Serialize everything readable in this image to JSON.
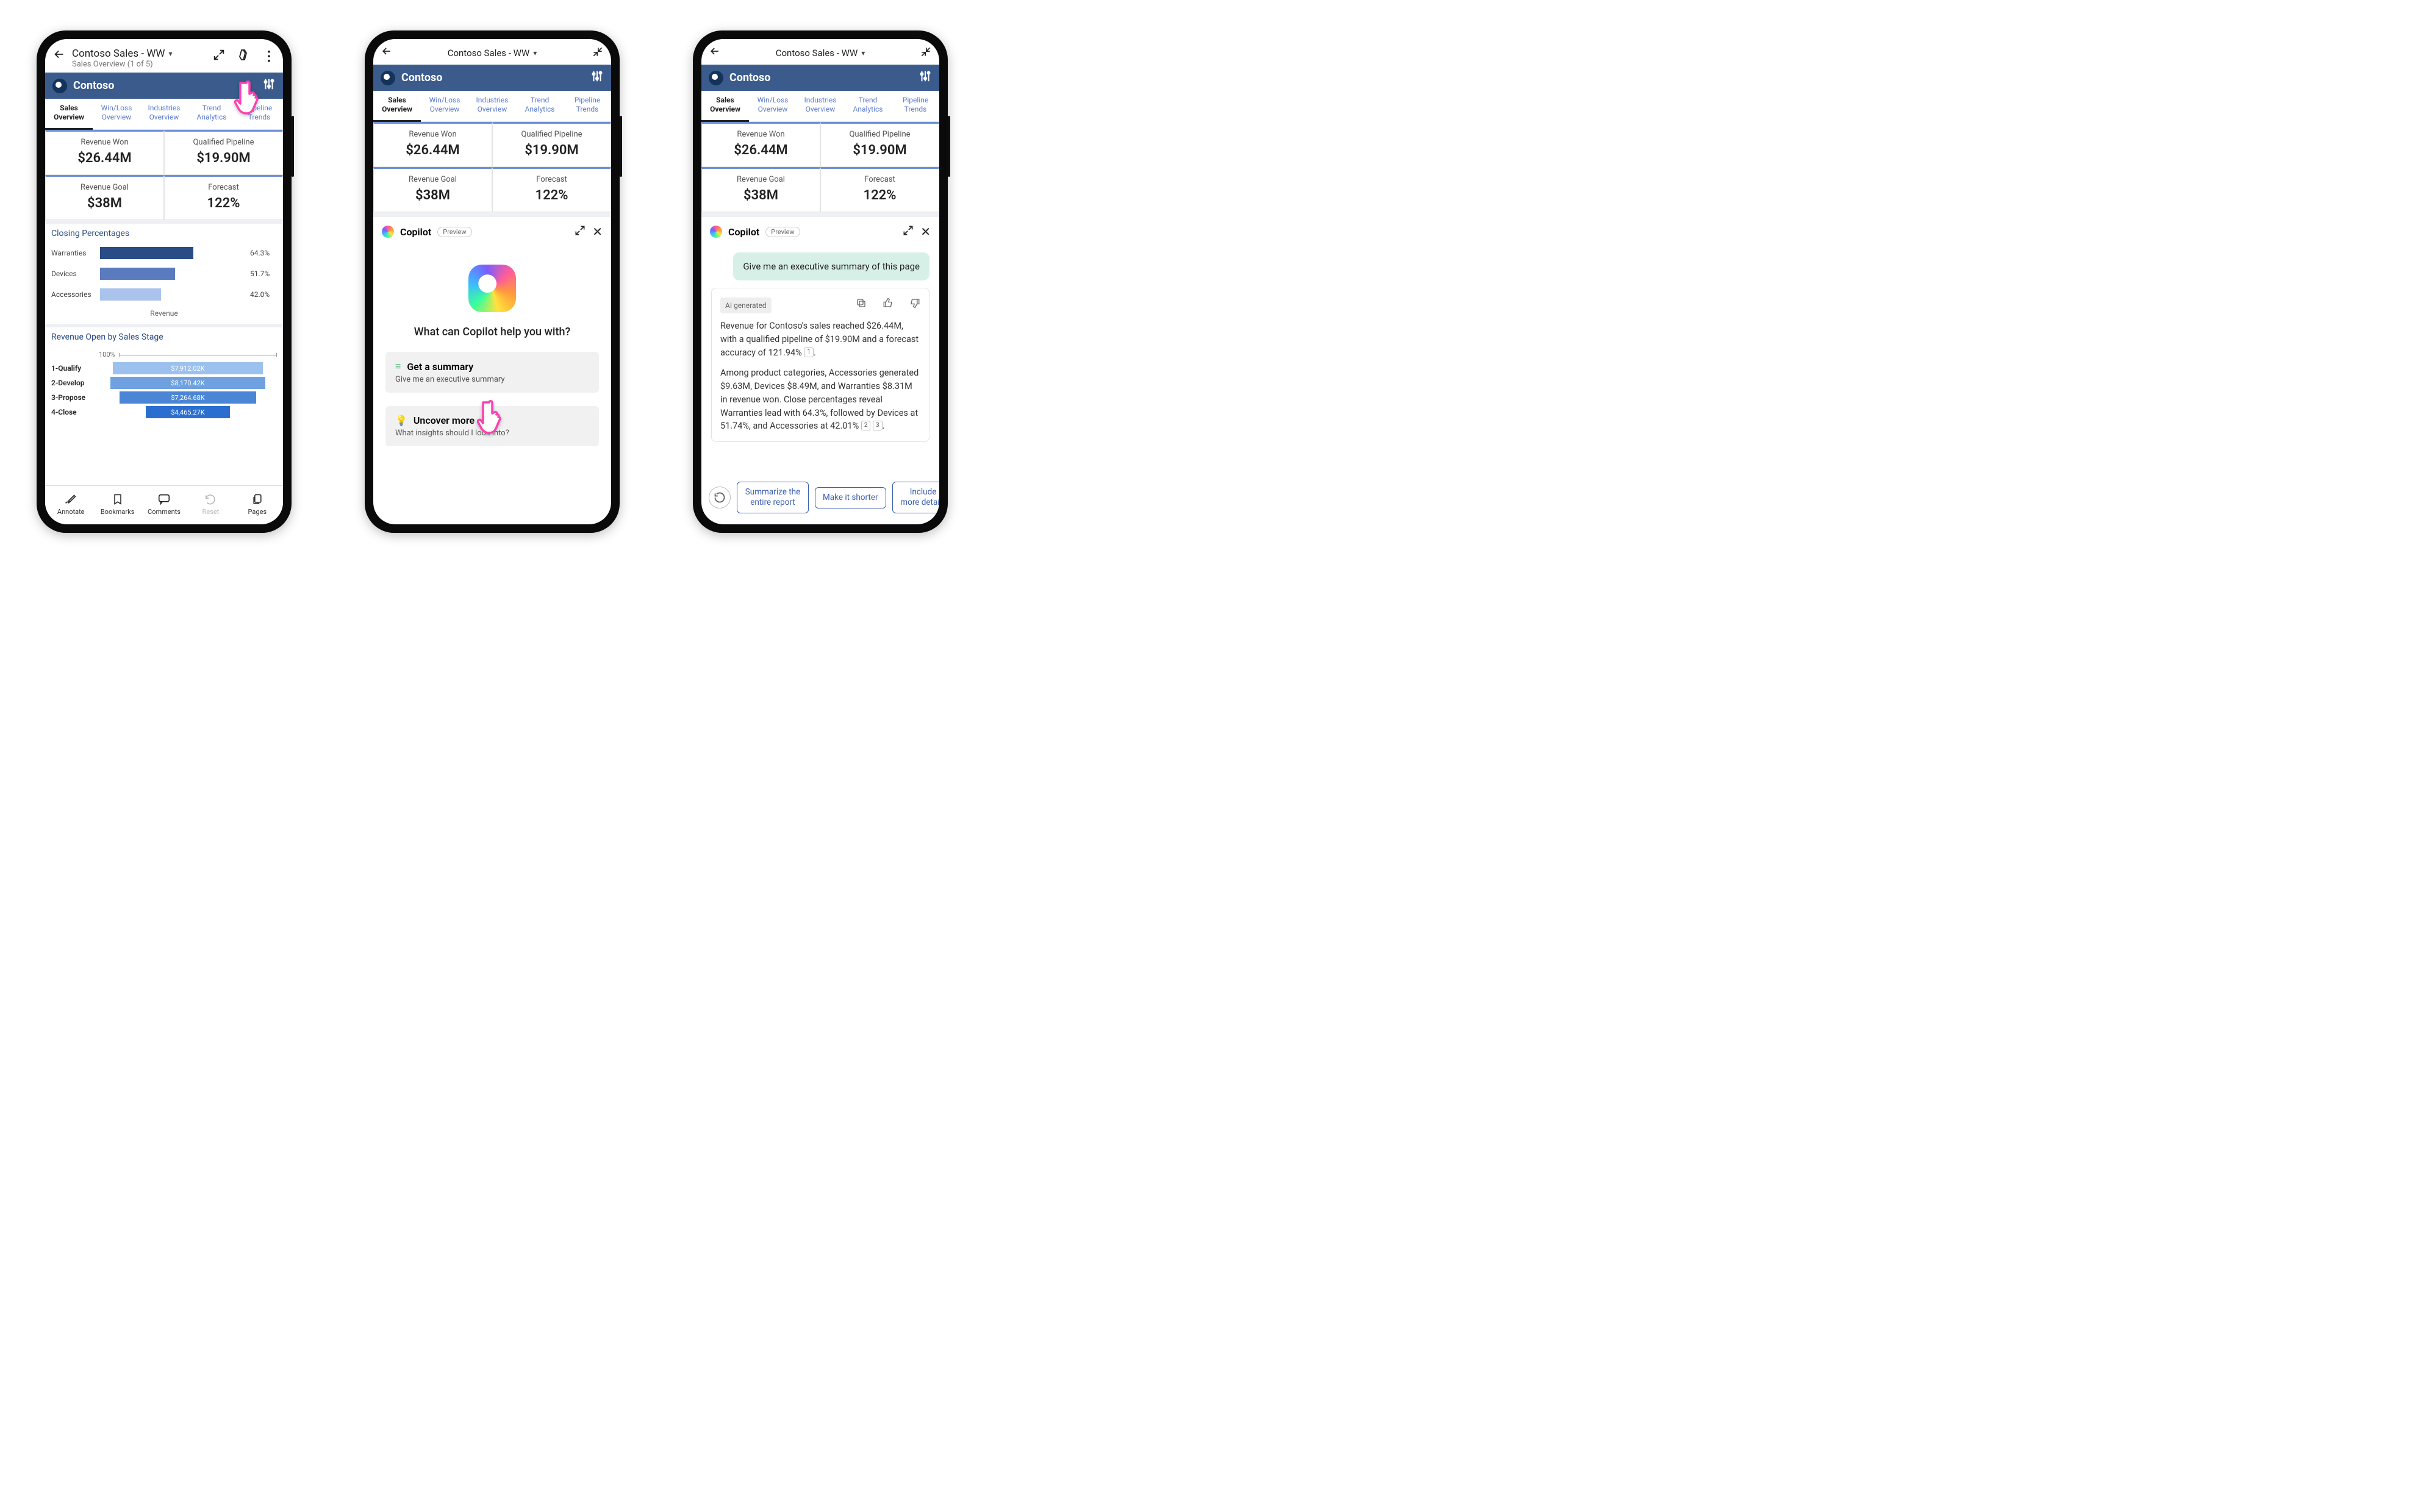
{
  "report": {
    "title": "Contoso Sales - WW",
    "subtitle": "Sales Overview (1 of 5)",
    "brand": "Contoso"
  },
  "tabs": [
    {
      "label": "Sales\nOverview",
      "selected": true
    },
    {
      "label": "Win/Loss\nOverview"
    },
    {
      "label": "Industries\nOverview"
    },
    {
      "label": "Trend\nAnalytics"
    },
    {
      "label": "Pipeline\nTrends"
    }
  ],
  "kpis": [
    {
      "label": "Revenue Won",
      "value": "$26.44M"
    },
    {
      "label": "Qualified Pipeline",
      "value": "$19.90M"
    },
    {
      "label": "Revenue Goal",
      "value": "$38M"
    },
    {
      "label": "Forecast",
      "value": "122%"
    }
  ],
  "chart_data": [
    {
      "type": "bar",
      "title": "Closing Percentages",
      "xlabel": "Revenue",
      "categories": [
        "Warranties",
        "Devices",
        "Accessories"
      ],
      "values": [
        64.3,
        51.7,
        42.0
      ],
      "value_labels": [
        "64.3%",
        "51.7%",
        "42.0%"
      ],
      "colors": [
        "#2a4c86",
        "#5b7bbf",
        "#a9c3ec"
      ],
      "xlim": [
        0,
        100
      ]
    },
    {
      "type": "bar",
      "title": "Revenue Open by Sales Stage",
      "scale_label": "100%",
      "categories": [
        "1-Qualify",
        "2-Develop",
        "3-Propose",
        "4-Close"
      ],
      "values": [
        7912.02,
        8170.42,
        7264.68,
        4465.27
      ],
      "value_labels": [
        "$7,912.02K",
        "$8,170.42K",
        "$7,264.68K",
        "$4,465.27K"
      ],
      "colors": [
        "#9cc1ee",
        "#6fa1e0",
        "#4b86d6",
        "#2a6fcf"
      ],
      "widths_pct": [
        84,
        87,
        77,
        47
      ]
    }
  ],
  "bottom_nav": [
    {
      "label": "Annotate",
      "icon": "pencil-wave-icon"
    },
    {
      "label": "Bookmarks",
      "icon": "bookmark-icon"
    },
    {
      "label": "Comments",
      "icon": "comment-icon"
    },
    {
      "label": "Reset",
      "icon": "undo-icon",
      "disabled": true
    },
    {
      "label": "Pages",
      "icon": "pages-icon"
    }
  ],
  "copilot": {
    "name": "Copilot",
    "badge": "Preview",
    "headline": "What can Copilot help you with?",
    "suggestions": [
      {
        "title": "Get a summary",
        "subtitle": "Give me an executive summary",
        "icon": "lines"
      },
      {
        "title": "Uncover more",
        "subtitle": "What insights should I look into?",
        "icon": "bulb"
      }
    ]
  },
  "chat": {
    "user_msg": "Give me an executive summary of this page",
    "ai_tag": "AI generated",
    "ai_para1_a": "Revenue for Contoso's sales reached $26.44M, with a qualified pipeline of $19.90M and a forecast accuracy of 121.94%",
    "cite1": "1",
    "ai_para2_a": "Among product categories, Accessories generated $9.63M, Devices $8.49M, and Warranties $8.31M in revenue won. Close percentages reveal Warranties lead with 64.3%, followed by Devices at 51.74%, and Accessories at 42.01%",
    "cite2": "2",
    "cite3": "3",
    "chips": [
      "Summarize the entire report",
      "Make it shorter",
      "Include more details"
    ]
  }
}
